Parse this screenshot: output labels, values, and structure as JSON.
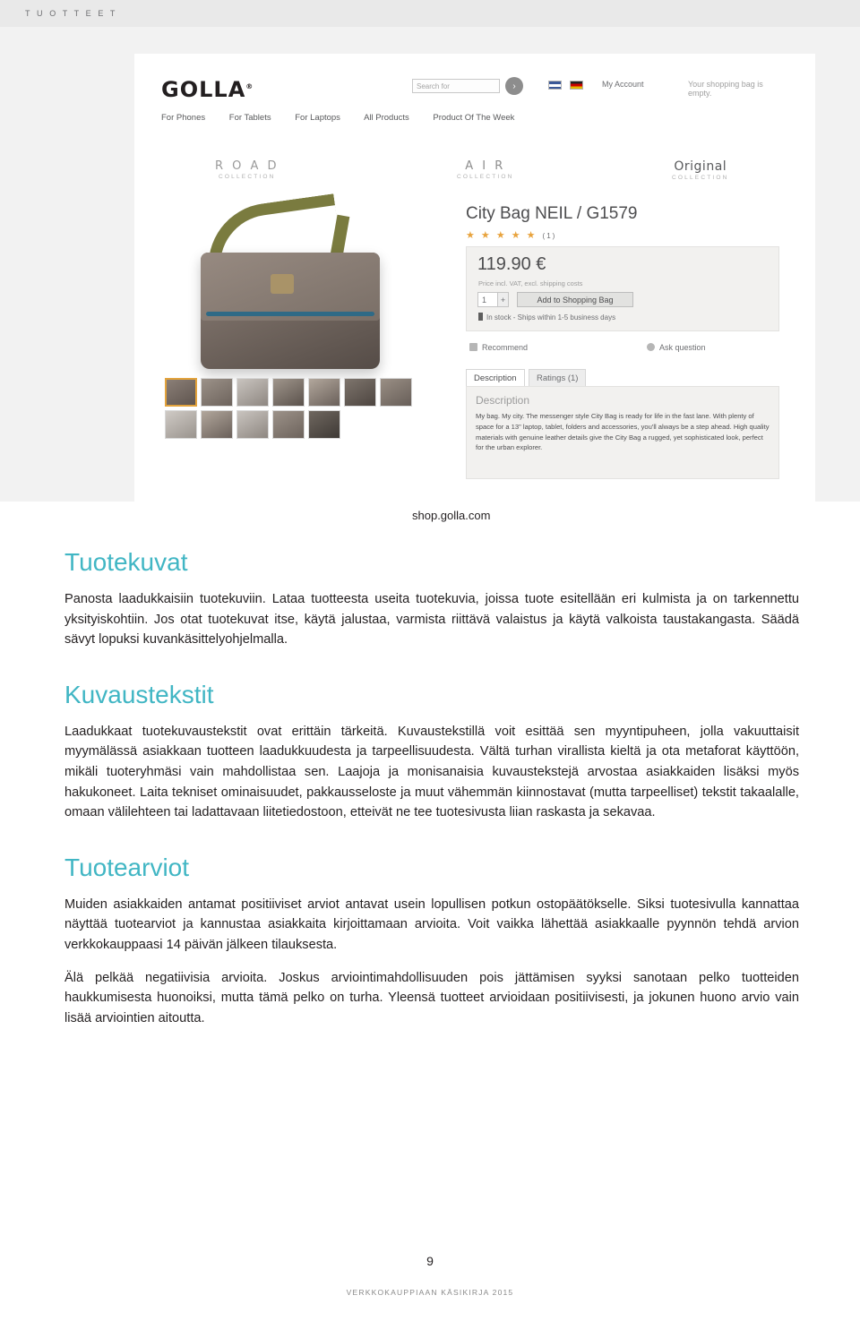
{
  "running_head": "T U O T T E E T",
  "screenshot": {
    "brand": "GOLLA",
    "brand_sup": "®",
    "search_placeholder": "Search for",
    "search_button_icon": "chevron-right-icon",
    "account_label": "My Account",
    "bag_label": "Your shopping bag is empty.",
    "flags": [
      "uk-flag",
      "de-flag"
    ],
    "nav": [
      "For Phones",
      "For Tablets",
      "For Laptops",
      "All Products",
      "Product Of The Week"
    ],
    "collections": [
      {
        "title": "R O A D",
        "sub": "COLLECTION"
      },
      {
        "title": "A I R",
        "sub": "COLLECTION"
      },
      {
        "title": "Original",
        "sub": "COLLECTION"
      }
    ],
    "product_name": "City Bag NEIL / G1579",
    "stars": "★ ★ ★ ★ ★",
    "rating_count": "(1)",
    "price": "119.90 €",
    "price_sub": "Price incl. VAT, excl. shipping costs",
    "qty_value": "1",
    "qty_plus": "+",
    "add_to_bag": "Add to Shopping Bag",
    "stock": "In stock - Ships within 1-5 business days",
    "recommend": "Recommend",
    "ask_question": "Ask question",
    "tabs": [
      {
        "label": "Description",
        "active": true
      },
      {
        "label": "Ratings (1)",
        "active": false
      }
    ],
    "description_title": "Description",
    "description_body": "My bag. My city. The messenger style City Bag is ready for life in the fast lane. With plenty of space for a 13\" laptop, tablet, folders and accessories, you'll always be a step ahead. High quality materials with genuine leather details give the City Bag a rugged, yet sophisticated look, perfect for the urban explorer.",
    "caption": "shop.golla.com"
  },
  "sections": [
    {
      "heading": "Tuotekuvat",
      "paragraphs": [
        "Panosta laadukkaisiin tuotekuviin. Lataa tuotteesta useita tuotekuvia, joissa tuote esitellään eri kulmista ja on tarkennettu yksityiskohtiin. Jos otat tuotekuvat itse, käytä jalustaa, varmista riittävä valaistus ja käytä valkoista taustakangasta. Säädä sävyt lopuksi kuvankäsittelyohjelmalla."
      ]
    },
    {
      "heading": "Kuvaustekstit",
      "paragraphs": [
        "Laadukkaat tuotekuvaustekstit ovat erittäin tärkeitä. Kuvaustekstillä voit esittää sen myyntipuheen, jolla vakuuttaisit myymälässä asiakkaan tuotteen laadukkuudesta ja tarpeellisuudesta. Vältä turhan virallista kieltä ja ota metaforat käyttöön, mikäli tuoteryhmäsi vain mahdollistaa sen. Laajoja ja monisanaisia kuvaustekstejä arvostaa asiakkaiden lisäksi myös hakukoneet. Laita tekniset ominaisuudet, pakkausseloste ja muut vähemmän kiinnostavat (mutta tarpeelliset) tekstit takaalalle, omaan välilehteen tai ladattavaan liitetiedostoon, etteivät ne tee tuotesivusta liian raskasta ja sekavaa."
      ]
    },
    {
      "heading": "Tuotearviot",
      "paragraphs": [
        "Muiden asiakkaiden antamat positiiviset arviot antavat usein lopullisen potkun ostopäätökselle. Siksi tuotesivulla kannattaa näyttää tuotearviot ja kannustaa asiakkaita kirjoittamaan arvioita. Voit vaikka lähettää asiakkaalle pyynnön tehdä arvion verkkokauppaasi 14 päivän jälkeen tilauksesta.",
        "Älä pelkää negatiivisia arvioita. Joskus arviointimahdollisuuden pois jättämisen syyksi sanotaan pelko tuotteiden haukkumisesta huonoiksi, mutta tämä pelko on turha. Yleensä tuotteet arvioidaan positiivisesti, ja jokunen huono arvio vain lisää arviointien aitoutta."
      ]
    }
  ],
  "footer": {
    "page_number": "9",
    "note": "VERKKOKAUPPIAAN KÄSIKIRJA 2015"
  },
  "colors": {
    "heading": "#41b6c4",
    "runhead_bg": "#e9e9e9",
    "shot_bg": "#f2f2f2"
  }
}
